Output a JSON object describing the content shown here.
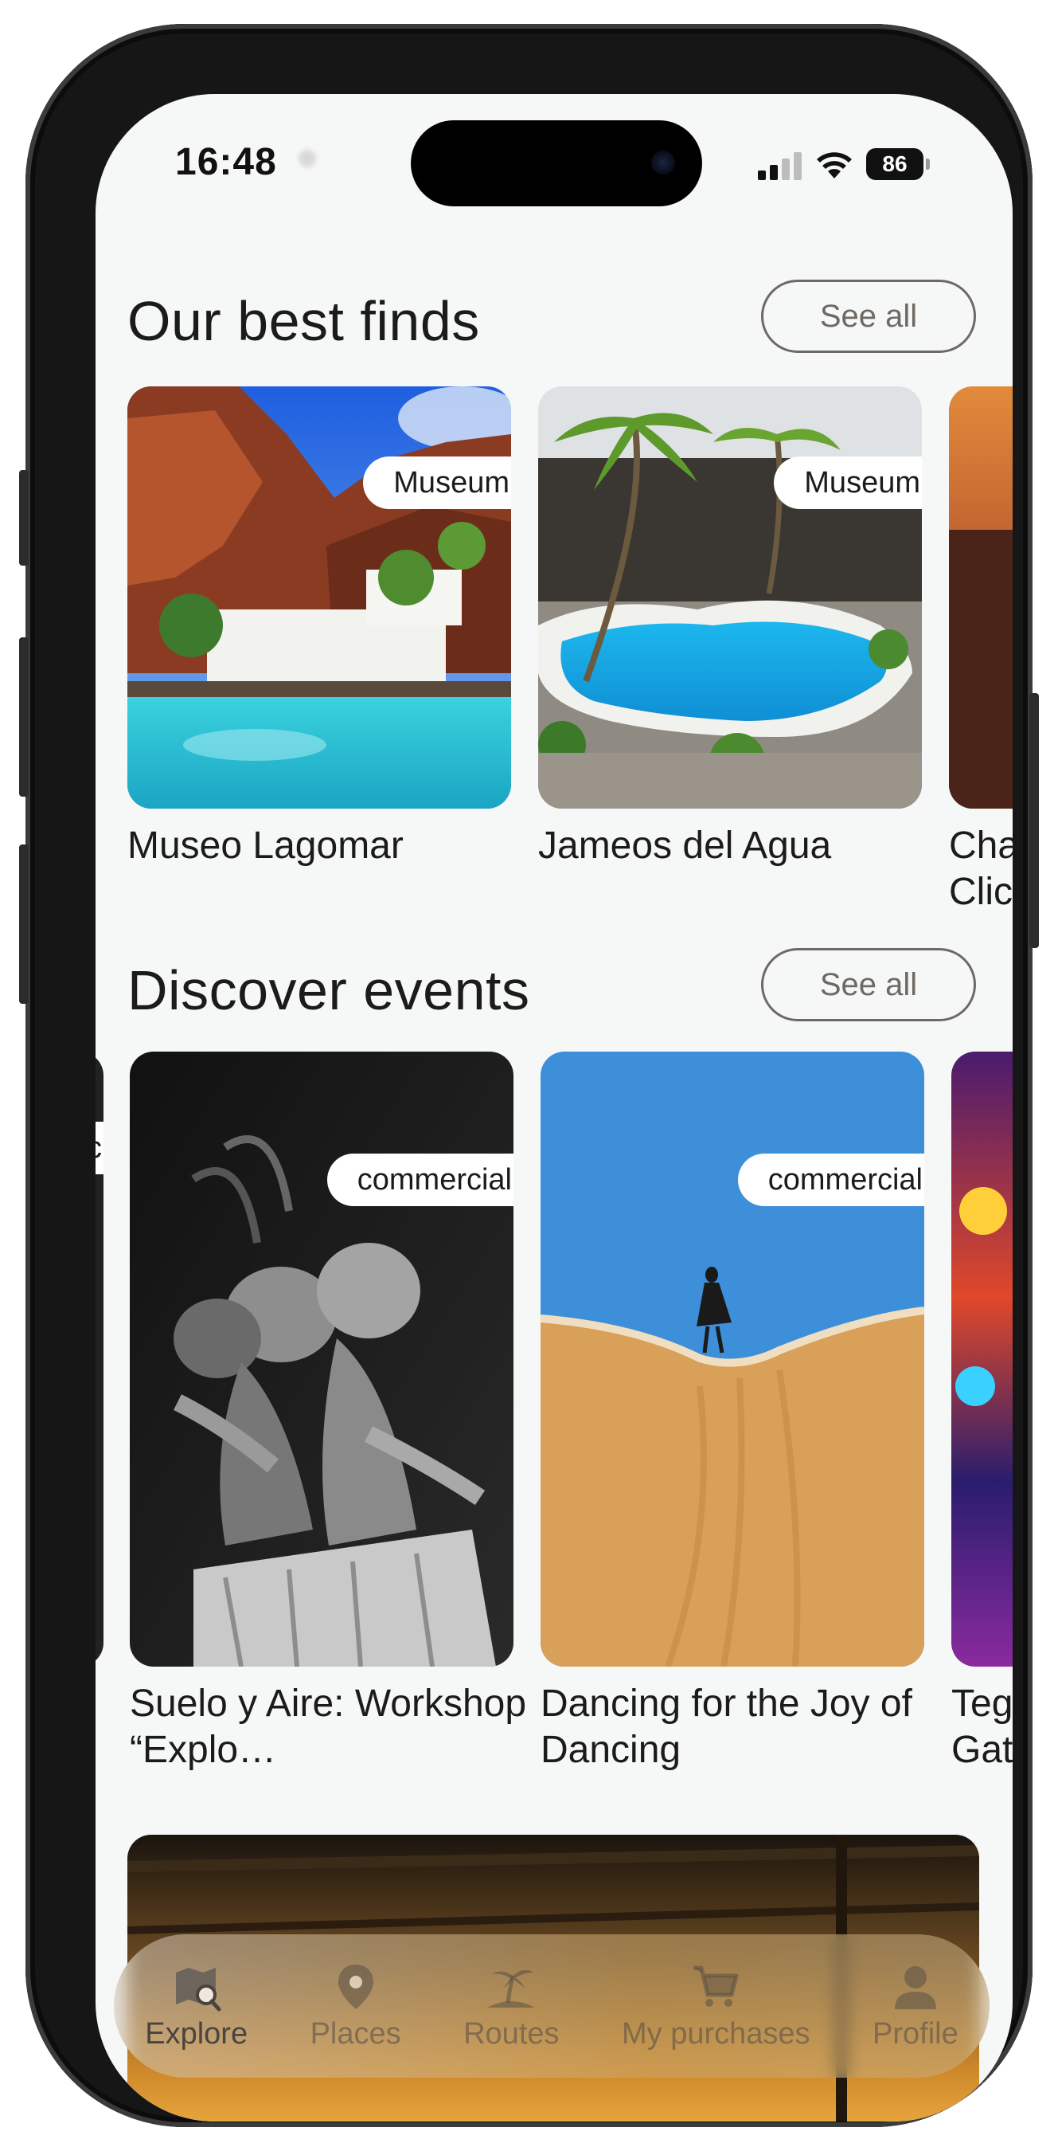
{
  "status_bar": {
    "time": "16:48",
    "battery": "86"
  },
  "best_finds": {
    "title": "Our best finds",
    "see_all": "See all",
    "cards": [
      {
        "title": "Museo Lagomar",
        "badge": "Museum"
      },
      {
        "title": "Jameos del Agua",
        "badge": "Museum"
      },
      {
        "title": "Cha… Clic…",
        "badge": ""
      }
    ]
  },
  "events": {
    "title": "Discover events",
    "see_all": "See all",
    "cards": [
      {
        "title": "Suelo y Aire: Workshop “Explo…",
        "badge": "commercial"
      },
      {
        "title": "Dancing for the Joy of Dancing",
        "badge": "commercial"
      },
      {
        "title": "Teg… Gat…",
        "badge": ""
      }
    ],
    "partial_left_badge": "c"
  },
  "nav": {
    "items": [
      {
        "label": "Explore",
        "icon": "map-search-icon"
      },
      {
        "label": "Places",
        "icon": "location-pin-icon"
      },
      {
        "label": "Routes",
        "icon": "palm-island-icon"
      },
      {
        "label": "My purchases",
        "icon": "cart-icon"
      },
      {
        "label": "Profile",
        "icon": "person-icon"
      }
    ]
  }
}
